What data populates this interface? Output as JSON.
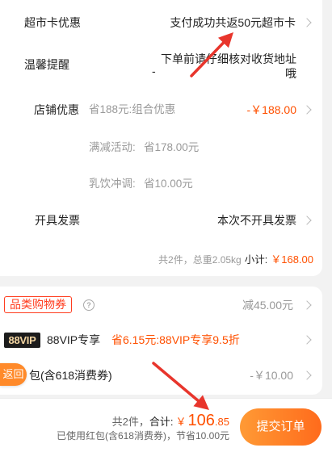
{
  "order_card": {
    "supermarket_card": {
      "label": "超市卡优惠",
      "value": "支付成功共返50元超市卡"
    },
    "notice": {
      "label": "温馨提醒",
      "dash": "-",
      "text_lines": [
        "下单前请仔细核对收货地址",
        "哦"
      ]
    },
    "shop_discount": {
      "label": "店铺优惠",
      "summary": "省188元:组合优惠",
      "amount": "-￥188.00",
      "details": [
        {
          "label": "满减活动:",
          "value": "省178.00元"
        },
        {
          "label": "乳饮冲调:",
          "value": "省10.00元"
        }
      ]
    },
    "invoice": {
      "label": "开具发票",
      "value": "本次不开具发票"
    },
    "subtotal": {
      "count_weight": "共2件，总重2.05kg",
      "label": "小计:",
      "amount": "￥168.00"
    }
  },
  "discount_card": {
    "category_coupon": {
      "tag": "品类购物券",
      "help_glyph": "?",
      "value": "减45.00元"
    },
    "vip": {
      "badge": "88VIP",
      "label": "88VIP专享",
      "offer": "省6.15元:88VIP专享9.5折"
    },
    "red_packet": {
      "label": "包(含618消费券)",
      "amount": "-￥10.00"
    }
  },
  "back_button": {
    "label": "返回"
  },
  "footer": {
    "count": "共2件，",
    "total_label": "合计:",
    "currency": "￥",
    "total_integer": "106",
    "total_decimal": ".85",
    "savings": "已使用红包(含618消费券)，节省10.00元",
    "submit_label": "提交订单"
  },
  "icons": {
    "row_chevron": "chevron-right-icon",
    "help": "question-circle-icon",
    "annotation": "arrow-icon"
  },
  "colors": {
    "accent": "#ff5000",
    "tag_red": "#ff3d1f",
    "annotation": "#e8352c",
    "button_orange": "#ff8a2a",
    "submit_from": "#ff9a35",
    "submit_to": "#ff6b1c",
    "vip_badge_bg": "#1c1c1c",
    "vip_badge_text": "#f3d5a2",
    "muted_text": "#999999",
    "secondary_text": "#666666",
    "primary_text": "#222222",
    "chevron": "#b8b8b8",
    "page_bg": "#f2f2f2"
  }
}
